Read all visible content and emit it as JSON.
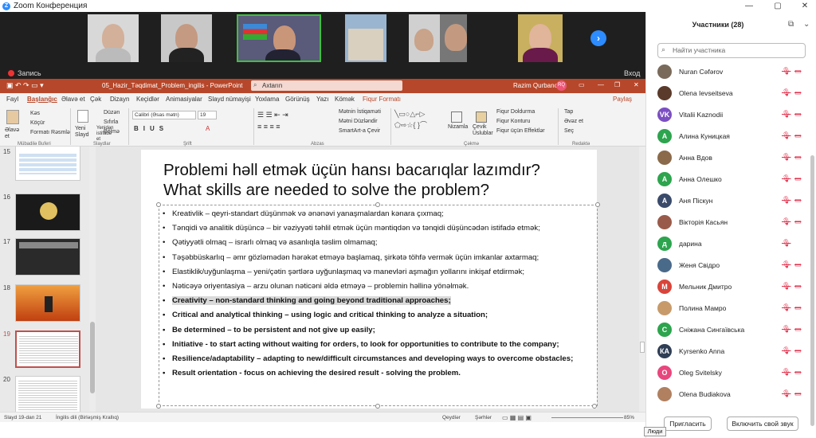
{
  "window": {
    "title": "Zoom Конференция",
    "min": "—",
    "max": "▢",
    "close": "✕"
  },
  "recording": {
    "label": "Запись",
    "enter": "Вход"
  },
  "ppt": {
    "filename": "05_Hazir_Təqdimat_Problem_ingilis - PowerPoint",
    "search": "Axtarın",
    "user": "Razim Qurbanov",
    "user_initials": "RQ",
    "menu": [
      "Fayl",
      "Başlanğıc",
      "Əlavə et",
      "Çək",
      "Dizayn",
      "Keçidlər",
      "Animasiyalar",
      "Slayd nümayişi",
      "Yoxlama",
      "Görünüş",
      "Yazı",
      "Kömək",
      "Fiqur Formatı"
    ],
    "share": "Paylaş",
    "ribbon": {
      "paste": "Əlavə et",
      "cut": "Kəs",
      "copy": "Köçür",
      "format_painter": "Formatı Rəsmlə",
      "clipboard": "Mübadilə Buferi",
      "new_slide": "Yeni Slayd",
      "reuse": "Yenidən istifadə et",
      "layout": "Düzən",
      "reset": "Sıfırla",
      "section": "Bölmə",
      "slides": "Slaydlar",
      "font_name": "Calibri (Əsas mətn)",
      "font_size": "19",
      "font": "Şrift",
      "text_dir": "Mətnin İstiqaməti",
      "align_text": "Mətni Düzləndir",
      "smartart": "SmartArt-a Çevir",
      "paragraph": "Abzas",
      "shape_fill": "Fiqur Doldurma",
      "shape_outline": "Fiqur Konturu",
      "shape_effects": "Fiqur üçün Effektlər",
      "arrange": "Nizamla",
      "quick_styles": "Çevik Üslublar",
      "drawing": "Çəkmə",
      "find": "Tap",
      "replace": "Əvəz et",
      "select": "Seç",
      "editing": "Redaktə"
    },
    "status": {
      "slide": "Slayd 19-dan 21",
      "lang": "İngilis dili (Birləşmiş Krallıq)",
      "notes": "Qeydlər",
      "comments": "Şərhlər",
      "zoom": "85%"
    }
  },
  "thumbs": [
    {
      "num": "15"
    },
    {
      "num": "16"
    },
    {
      "num": "17"
    },
    {
      "num": "18"
    },
    {
      "num": "19"
    },
    {
      "num": "20"
    }
  ],
  "slide": {
    "title1": "Problemi həll etmək üçün hansı bacarıqlar lazımdır?",
    "title2": "What skills are needed to solve the problem?",
    "bullets": [
      "Kreativlik – qeyri-standart düşünmək və ənənəvi yanaşmalardan kənara çıxmaq;",
      "Tənqidi və analitik düşüncə – bir vəziyyəti təhlil etmək üçün məntiqdən və tənqidi düşüncədən istifadə etmək;",
      "Qətiyyətli olmaq – israrlı olmaq və asanlıqla təslim olmamaq;",
      "Təşəbbüskarlıq – əmr gözləmədən hərəkət etməyə başlamaq, şirkətə töhfə vermək üçün imkanlar axtarmaq;",
      "Elastiklik/uyğunlaşma – yeni/çətin şərtlərə uyğunlaşmaq və manevləri aşmağın yollarını inkişaf etdirmək;",
      "Nəticəyə oriyentasiya – arzu olunan nəticəni əldə etməyə – problemin həllinə yönəlmək.",
      "Creativity – non-standard thinking and going beyond traditional approaches;",
      "Critical and analytical thinking – using logic and critical thinking to analyze a situation;",
      "Be determined – to be persistent and not give up easily;",
      "Initiative - to start acting without waiting for orders, to look for opportunities to contribute to the company;",
      "Resilience/adaptability – adapting to new/difficult circumstances and developing ways to overcome obstacles;",
      "Result orientation - focus on achieving the desired result - solving the problem."
    ]
  },
  "participants": {
    "title": "Участники (28)",
    "search_placeholder": "Найти участника",
    "list": [
      {
        "name": "Nuran Cəfərov",
        "initials": "",
        "color": "#7a6a5a"
      },
      {
        "name": "Olena Ievseitseva",
        "initials": "",
        "color": "#5a3a2a"
      },
      {
        "name": "Vitalii Kaznodii",
        "initials": "VK",
        "color": "#7b4fc2"
      },
      {
        "name": "Алина Куницкая",
        "initials": "А",
        "color": "#2da44e"
      },
      {
        "name": "Анна Вдов",
        "initials": "",
        "color": "#8a6a4a"
      },
      {
        "name": "Анна Олешко",
        "initials": "А",
        "color": "#2da44e"
      },
      {
        "name": "Аня Піскун",
        "initials": "А",
        "color": "#3a4a6a"
      },
      {
        "name": "Вікторія Касьян",
        "initials": "",
        "color": "#9a5a4a"
      },
      {
        "name": "дарина",
        "initials": "д",
        "color": "#2da44e"
      },
      {
        "name": "Женя Свідро",
        "initials": "",
        "color": "#4a6a8a"
      },
      {
        "name": "Мельник Дмитро",
        "initials": "М",
        "color": "#d9443a"
      },
      {
        "name": "Полина Мамро",
        "initials": "",
        "color": "#c89a6a"
      },
      {
        "name": "Сніжана Сингаївська",
        "initials": "С",
        "color": "#2da44e"
      },
      {
        "name": "Kyrsenko Anna",
        "initials": "КА",
        "color": "#2f3e55"
      },
      {
        "name": "Oleg Svitelsky",
        "initials": "О",
        "color": "#e8467c"
      },
      {
        "name": "Olena Budiakova",
        "initials": "",
        "color": "#b08060"
      }
    ],
    "invite": "Пригласить",
    "unmute_all": "Включить свой звук",
    "tooltip": "Люди"
  }
}
